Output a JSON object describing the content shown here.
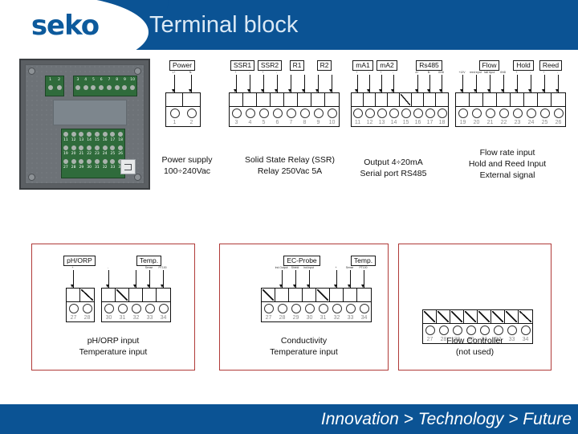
{
  "header": {
    "logo_text": "seko",
    "title": "Terminal block",
    "brand_blue": "#0b5394",
    "title_color": "#dbe9f5"
  },
  "footer": {
    "tagline": "Innovation > Technology > Future"
  },
  "panel_photo": {
    "name": "terminal-block-panel-photo",
    "terminal_groups": [
      {
        "numbers": [
          "1",
          "2"
        ]
      },
      {
        "numbers": [
          "3",
          "4",
          "5",
          "6",
          "7",
          "8",
          "9",
          "10"
        ]
      },
      {
        "numbers": [
          "11",
          "12",
          "13",
          "14",
          "15",
          "16",
          "17",
          "18"
        ]
      },
      {
        "numbers": [
          "19",
          "20",
          "21",
          "22",
          "23",
          "24",
          "25",
          "26"
        ]
      },
      {
        "numbers": [
          "27",
          "28",
          "29",
          "30",
          "31",
          "32",
          "33",
          "34"
        ]
      }
    ]
  },
  "diagrams": {
    "power": {
      "tags": [
        {
          "label": "Power",
          "span": 2
        }
      ],
      "pin_labels": [
        "L+",
        "N-"
      ],
      "numbers": [
        "1",
        "2"
      ],
      "slashed": [],
      "caption": [
        "Power supply",
        "100÷240Vac"
      ]
    },
    "ssr": {
      "tags": [
        {
          "label": "SSR1",
          "span": 2
        },
        {
          "label": "SSR2",
          "span": 2
        },
        {
          "label": "R1",
          "span": 2
        },
        {
          "label": "R2",
          "span": 2
        }
      ],
      "pin_labels": [
        "+",
        "-",
        "+",
        "-",
        "",
        "",
        "",
        ""
      ],
      "numbers": [
        "3",
        "4",
        "5",
        "6",
        "7",
        "8",
        "9",
        "10"
      ],
      "slashed": [],
      "caption": [
        "Solid State Relay (SSR)",
        "Relay 250Vac 5A"
      ]
    },
    "ma_rs485": {
      "tags": [
        {
          "label": "mA1",
          "span": 2
        },
        {
          "label": "mA2",
          "span": 2
        },
        {
          "label": "",
          "span": 1
        },
        {
          "label": "Rs485",
          "span": 3
        }
      ],
      "pin_labels": [
        "+",
        "-",
        "+",
        "-",
        "",
        "A+",
        "B-",
        "GND"
      ],
      "numbers": [
        "11",
        "12",
        "13",
        "14",
        "15",
        "16",
        "17",
        "18"
      ],
      "slashed": [
        4
      ],
      "caption": [
        "Output 4÷20mA",
        "Serial port RS485"
      ]
    },
    "flow_hold_reed": {
      "tags": [
        {
          "label": "",
          "span": 1
        },
        {
          "label": "Flow",
          "span": 3
        },
        {
          "label": "Hold",
          "span": 2
        },
        {
          "label": "Reed",
          "span": 2
        }
      ],
      "pin_labels": [
        "+12V",
        "reed input",
        "hall input",
        "GND",
        "+",
        "-",
        "+",
        "-"
      ],
      "numbers": [
        "19",
        "20",
        "21",
        "22",
        "23",
        "24",
        "25",
        "26"
      ],
      "slashed": [],
      "caption": [
        "Flow rate input",
        "Hold and Reed Input",
        "External signal"
      ]
    }
  },
  "bottom_boxes": [
    {
      "name": "ph-orp-input-box",
      "groups": [
        {
          "tags": [
            {
              "label": "pH/ORP",
              "span": 2
            }
          ],
          "pin_labels": [
            "+",
            ""
          ],
          "numbers": [
            "27",
            "28"
          ],
          "slashed": [
            1
          ]
        },
        {
          "tags": [
            {
              "label": "",
              "span": 1
            },
            {
              "label": "",
              "span": 1
            },
            {
              "label": "Temp.",
              "span": 3
            }
          ],
          "pin_labels": [
            "-",
            "",
            "",
            "Sense",
            "PT100"
          ],
          "numbers": [
            "30",
            "31",
            "32",
            "33",
            "34"
          ],
          "slashed": [
            1
          ]
        }
      ],
      "caption": [
        "pH/ORP input",
        "Temperature input"
      ]
    },
    {
      "name": "conductivity-input-box",
      "groups": [
        {
          "tags": [
            {
              "label": "",
              "span": 1
            },
            {
              "label": "EC-Probe",
              "span": 4
            },
            {
              "label": "",
              "span": 1
            },
            {
              "label": "Temp.",
              "span": 3
            }
          ],
          "pin_labels": [
            "",
            "Ind.Output",
            "Shield",
            "Ind.Input",
            "",
            "+",
            "Sense",
            "PT100"
          ],
          "numbers": [
            "27",
            "28",
            "29",
            "30",
            "31",
            "32",
            "33",
            "34"
          ],
          "slashed": [
            0,
            4
          ]
        }
      ],
      "caption": [
        "Conductivity",
        "Temperature input"
      ]
    },
    {
      "name": "flow-controller-box",
      "groups": [
        {
          "tags": [],
          "pin_labels": [
            "",
            "",
            "",
            "",
            "",
            "",
            "",
            ""
          ],
          "numbers": [
            "27",
            "28",
            "29",
            "30",
            "31",
            "32",
            "33",
            "34"
          ],
          "slashed": [
            0,
            1,
            2,
            3,
            4,
            5,
            6,
            7
          ]
        }
      ],
      "caption": [
        "Flow Controller",
        "(not used)"
      ]
    }
  ]
}
